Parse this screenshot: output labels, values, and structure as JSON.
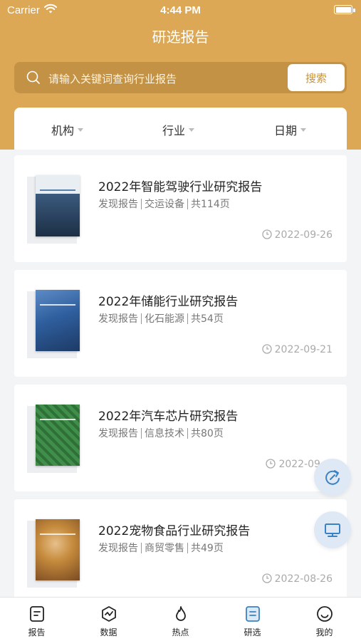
{
  "status_bar": {
    "carrier": "Carrier",
    "time": "4:44 PM"
  },
  "header": {
    "title": "研选报告"
  },
  "search": {
    "placeholder": "请输入关键词查询行业报告",
    "button_label": "搜索"
  },
  "filters": [
    {
      "label": "机构"
    },
    {
      "label": "行业"
    },
    {
      "label": "日期"
    }
  ],
  "reports": [
    {
      "title": "2022年智能驾驶行业研究报告",
      "type": "发现报告",
      "industry": "交运设备",
      "pages": "共114页",
      "date": "2022-09-26",
      "cover_color": "#3b5a7e"
    },
    {
      "title": "2022年储能行业研究报告",
      "type": "发现报告",
      "industry": "化石能源",
      "pages": "共54页",
      "date": "2022-09-21",
      "cover_color": "#2f5f9e"
    },
    {
      "title": "2022年汽车芯片研究报告",
      "type": "发现报告",
      "industry": "信息技术",
      "pages": "共80页",
      "date": "2022-09-",
      "cover_color": "#3f8f4a"
    },
    {
      "title": "2022宠物食品行业研究报告",
      "type": "发现报告",
      "industry": "商贸零售",
      "pages": "共49页",
      "date": "2022-08-26",
      "cover_color": "#c58a3c"
    }
  ],
  "tabs": [
    {
      "label": "报告",
      "icon": "report-doc-icon"
    },
    {
      "label": "数据",
      "icon": "data-chart-icon"
    },
    {
      "label": "热点",
      "icon": "flame-icon"
    },
    {
      "label": "研选",
      "icon": "research-icon",
      "active": true
    },
    {
      "label": "我的",
      "icon": "smiley-icon"
    }
  ],
  "colors": {
    "accent": "#dda855",
    "active_tab": "#3b82c4"
  }
}
